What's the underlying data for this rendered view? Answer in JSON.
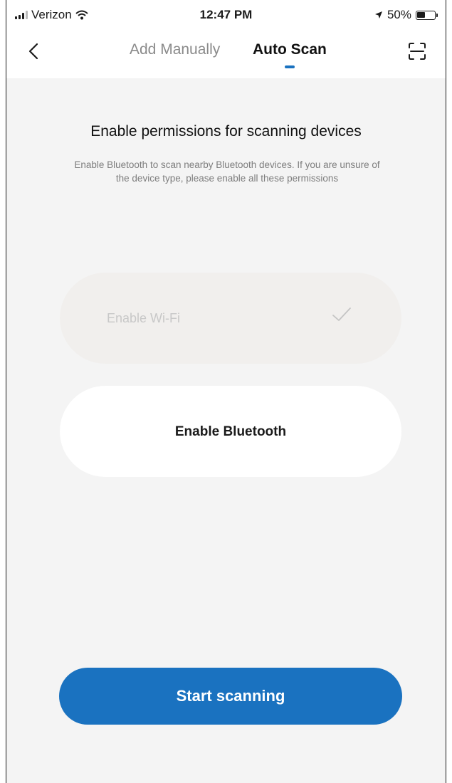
{
  "status_bar": {
    "carrier": "Verizon",
    "time": "12:47 PM",
    "battery": "50%",
    "icons": [
      "signal-icon",
      "wifi-icon",
      "location-arrow-icon",
      "battery-icon"
    ]
  },
  "nav": {
    "back_icon": "chevron-left-icon",
    "tabs": [
      {
        "label": "Add Manually",
        "active": false
      },
      {
        "label": "Auto Scan",
        "active": true
      }
    ],
    "scan_icon": "scan-frame-icon"
  },
  "content": {
    "heading": "Enable permissions for scanning devices",
    "description": "Enable Bluetooth to scan nearby Bluetooth devices. If you are unsure of the device type, please enable all these permissions"
  },
  "permissions": [
    {
      "label": "Enable Wi-Fi",
      "enabled": true,
      "icon": "checkmark-icon"
    },
    {
      "label": "Enable Bluetooth",
      "enabled": false
    }
  ],
  "start_button": {
    "label": "Start scanning"
  },
  "colors": {
    "accent": "#1a72c0",
    "background": "#f4f4f4",
    "disabled_pill": "#f1efed"
  }
}
